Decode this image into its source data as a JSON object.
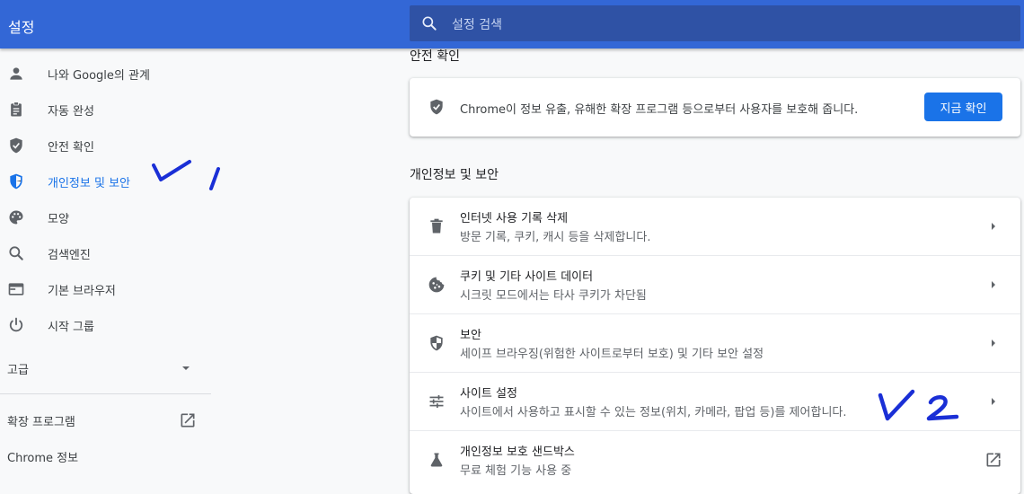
{
  "header": {
    "title": "설정",
    "search_placeholder": "설정 검색"
  },
  "sidebar": {
    "items": [
      {
        "label": "나와 Google의 관계",
        "icon": "person-icon"
      },
      {
        "label": "자동 완성",
        "icon": "clipboard-icon"
      },
      {
        "label": "안전 확인",
        "icon": "shield-check-icon"
      },
      {
        "label": "개인정보 및 보안",
        "icon": "shield-blue-icon",
        "active": true
      },
      {
        "label": "모양",
        "icon": "palette-icon"
      },
      {
        "label": "검색엔진",
        "icon": "search-icon"
      },
      {
        "label": "기본 브라우저",
        "icon": "browser-icon"
      },
      {
        "label": "시작 그룹",
        "icon": "power-icon"
      }
    ],
    "advanced_label": "고급",
    "extensions_label": "확장 프로그램",
    "about_label": "Chrome 정보"
  },
  "safety": {
    "section_title": "안전 확인",
    "description": "Chrome이 정보 유출, 유해한 확장 프로그램 등으로부터 사용자를 보호해 줍니다.",
    "button_label": "지금 확인"
  },
  "privacy": {
    "section_title": "개인정보 및 보안",
    "rows": [
      {
        "title": "인터넷 사용 기록 삭제",
        "subtitle": "방문 기록, 쿠키, 캐시 등을 삭제합니다.",
        "icon": "trash-icon"
      },
      {
        "title": "쿠키 및 기타 사이트 데이터",
        "subtitle": "시크릿 모드에서는 타사 쿠키가 차단됨",
        "icon": "cookie-icon"
      },
      {
        "title": "보안",
        "subtitle": "세이프 브라우징(위험한 사이트로부터 보호) 및 기타 보안 설정",
        "icon": "security-shield-icon"
      },
      {
        "title": "사이트 설정",
        "subtitle": "사이트에서 사용하고 표시할 수 있는 정보(위치, 카메라, 팝업 등)를 제어합니다.",
        "icon": "tune-icon"
      },
      {
        "title": "개인정보 보호 샌드박스",
        "subtitle": "무료 체험 기능 사용 중",
        "icon": "flask-icon"
      }
    ]
  },
  "colors": {
    "header": "#3367d6",
    "accent": "#1a73e8",
    "annotation_ink": "#1a2fd6"
  }
}
